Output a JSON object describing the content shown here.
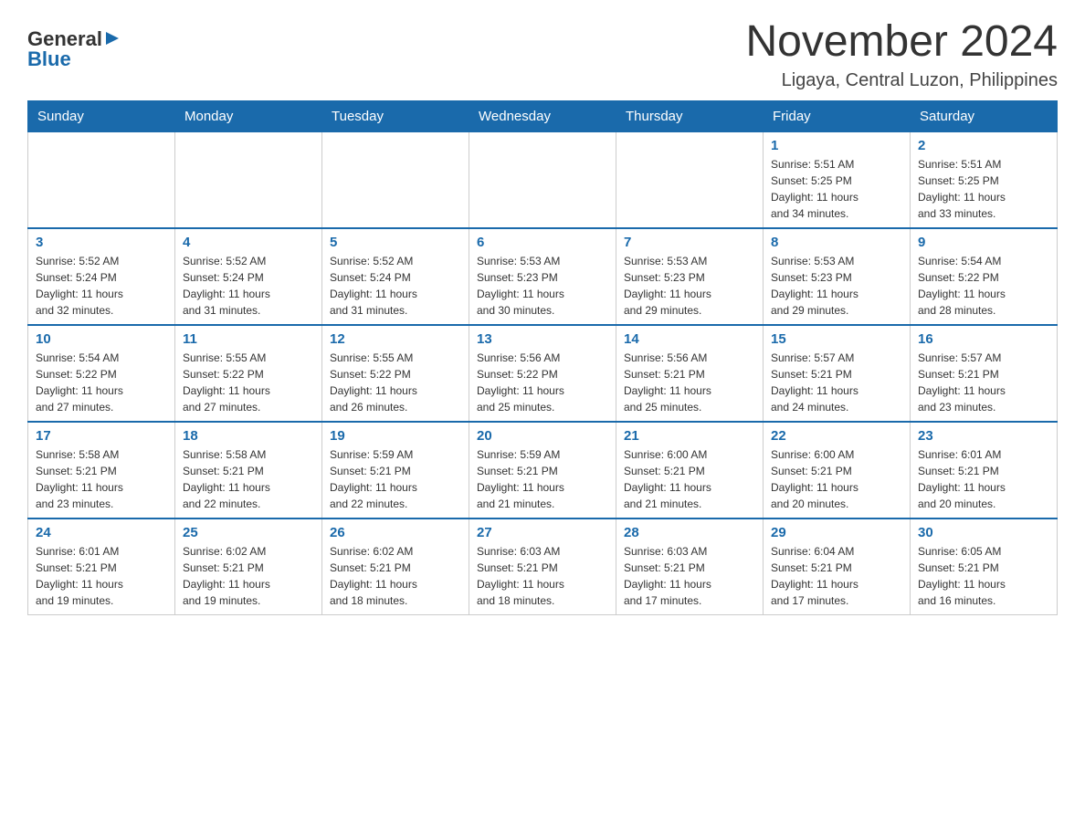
{
  "header": {
    "logo_general": "General",
    "logo_blue": "Blue",
    "month_title": "November 2024",
    "location": "Ligaya, Central Luzon, Philippines"
  },
  "weekdays": [
    "Sunday",
    "Monday",
    "Tuesday",
    "Wednesday",
    "Thursday",
    "Friday",
    "Saturday"
  ],
  "weeks": [
    [
      {
        "day": "",
        "info": ""
      },
      {
        "day": "",
        "info": ""
      },
      {
        "day": "",
        "info": ""
      },
      {
        "day": "",
        "info": ""
      },
      {
        "day": "",
        "info": ""
      },
      {
        "day": "1",
        "info": "Sunrise: 5:51 AM\nSunset: 5:25 PM\nDaylight: 11 hours\nand 34 minutes."
      },
      {
        "day": "2",
        "info": "Sunrise: 5:51 AM\nSunset: 5:25 PM\nDaylight: 11 hours\nand 33 minutes."
      }
    ],
    [
      {
        "day": "3",
        "info": "Sunrise: 5:52 AM\nSunset: 5:24 PM\nDaylight: 11 hours\nand 32 minutes."
      },
      {
        "day": "4",
        "info": "Sunrise: 5:52 AM\nSunset: 5:24 PM\nDaylight: 11 hours\nand 31 minutes."
      },
      {
        "day": "5",
        "info": "Sunrise: 5:52 AM\nSunset: 5:24 PM\nDaylight: 11 hours\nand 31 minutes."
      },
      {
        "day": "6",
        "info": "Sunrise: 5:53 AM\nSunset: 5:23 PM\nDaylight: 11 hours\nand 30 minutes."
      },
      {
        "day": "7",
        "info": "Sunrise: 5:53 AM\nSunset: 5:23 PM\nDaylight: 11 hours\nand 29 minutes."
      },
      {
        "day": "8",
        "info": "Sunrise: 5:53 AM\nSunset: 5:23 PM\nDaylight: 11 hours\nand 29 minutes."
      },
      {
        "day": "9",
        "info": "Sunrise: 5:54 AM\nSunset: 5:22 PM\nDaylight: 11 hours\nand 28 minutes."
      }
    ],
    [
      {
        "day": "10",
        "info": "Sunrise: 5:54 AM\nSunset: 5:22 PM\nDaylight: 11 hours\nand 27 minutes."
      },
      {
        "day": "11",
        "info": "Sunrise: 5:55 AM\nSunset: 5:22 PM\nDaylight: 11 hours\nand 27 minutes."
      },
      {
        "day": "12",
        "info": "Sunrise: 5:55 AM\nSunset: 5:22 PM\nDaylight: 11 hours\nand 26 minutes."
      },
      {
        "day": "13",
        "info": "Sunrise: 5:56 AM\nSunset: 5:22 PM\nDaylight: 11 hours\nand 25 minutes."
      },
      {
        "day": "14",
        "info": "Sunrise: 5:56 AM\nSunset: 5:21 PM\nDaylight: 11 hours\nand 25 minutes."
      },
      {
        "day": "15",
        "info": "Sunrise: 5:57 AM\nSunset: 5:21 PM\nDaylight: 11 hours\nand 24 minutes."
      },
      {
        "day": "16",
        "info": "Sunrise: 5:57 AM\nSunset: 5:21 PM\nDaylight: 11 hours\nand 23 minutes."
      }
    ],
    [
      {
        "day": "17",
        "info": "Sunrise: 5:58 AM\nSunset: 5:21 PM\nDaylight: 11 hours\nand 23 minutes."
      },
      {
        "day": "18",
        "info": "Sunrise: 5:58 AM\nSunset: 5:21 PM\nDaylight: 11 hours\nand 22 minutes."
      },
      {
        "day": "19",
        "info": "Sunrise: 5:59 AM\nSunset: 5:21 PM\nDaylight: 11 hours\nand 22 minutes."
      },
      {
        "day": "20",
        "info": "Sunrise: 5:59 AM\nSunset: 5:21 PM\nDaylight: 11 hours\nand 21 minutes."
      },
      {
        "day": "21",
        "info": "Sunrise: 6:00 AM\nSunset: 5:21 PM\nDaylight: 11 hours\nand 21 minutes."
      },
      {
        "day": "22",
        "info": "Sunrise: 6:00 AM\nSunset: 5:21 PM\nDaylight: 11 hours\nand 20 minutes."
      },
      {
        "day": "23",
        "info": "Sunrise: 6:01 AM\nSunset: 5:21 PM\nDaylight: 11 hours\nand 20 minutes."
      }
    ],
    [
      {
        "day": "24",
        "info": "Sunrise: 6:01 AM\nSunset: 5:21 PM\nDaylight: 11 hours\nand 19 minutes."
      },
      {
        "day": "25",
        "info": "Sunrise: 6:02 AM\nSunset: 5:21 PM\nDaylight: 11 hours\nand 19 minutes."
      },
      {
        "day": "26",
        "info": "Sunrise: 6:02 AM\nSunset: 5:21 PM\nDaylight: 11 hours\nand 18 minutes."
      },
      {
        "day": "27",
        "info": "Sunrise: 6:03 AM\nSunset: 5:21 PM\nDaylight: 11 hours\nand 18 minutes."
      },
      {
        "day": "28",
        "info": "Sunrise: 6:03 AM\nSunset: 5:21 PM\nDaylight: 11 hours\nand 17 minutes."
      },
      {
        "day": "29",
        "info": "Sunrise: 6:04 AM\nSunset: 5:21 PM\nDaylight: 11 hours\nand 17 minutes."
      },
      {
        "day": "30",
        "info": "Sunrise: 6:05 AM\nSunset: 5:21 PM\nDaylight: 11 hours\nand 16 minutes."
      }
    ]
  ]
}
